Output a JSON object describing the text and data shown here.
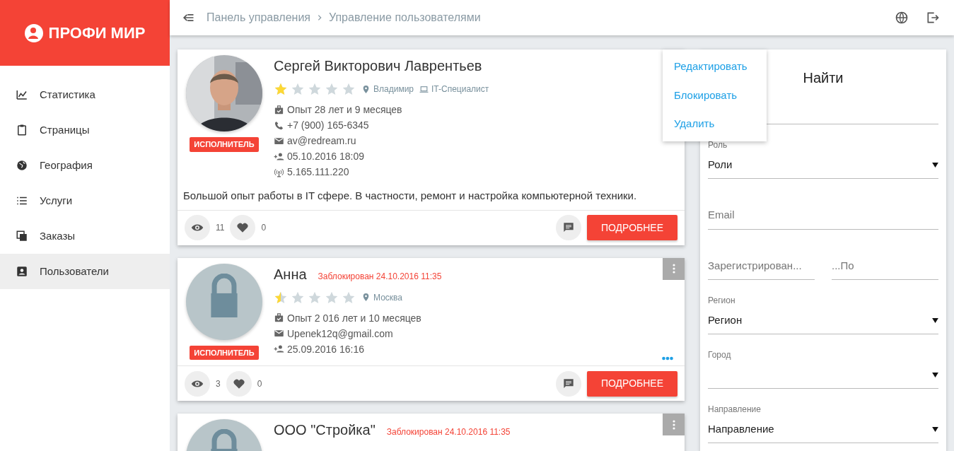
{
  "brand": {
    "name": "ПРОФИ МИР"
  },
  "sidebar": {
    "items": [
      {
        "label": "Статистика",
        "selected": false
      },
      {
        "label": "Страницы",
        "selected": false
      },
      {
        "label": "География",
        "selected": false
      },
      {
        "label": "Услуги",
        "selected": false
      },
      {
        "label": "Заказы",
        "selected": false
      },
      {
        "label": "Пользователи",
        "selected": true
      }
    ]
  },
  "breadcrumb": [
    "Панель управления",
    "Управление пользователями"
  ],
  "users": [
    {
      "name": "Сергей Викторович Лаврентьев",
      "stars": 1,
      "badge": "ИСПОЛНИТЕЛЬ",
      "menu_open": true,
      "meta": [
        {
          "kind": "city",
          "text": "Владимир"
        },
        {
          "kind": "profession",
          "text": "IT-Специалист"
        }
      ],
      "details": [
        {
          "kind": "experience",
          "text": "Опыт 28 лет и 9 месяцев"
        },
        {
          "kind": "phone",
          "text": "+7 (900) 165-6345"
        },
        {
          "kind": "email",
          "text": "av@redream.ru"
        },
        {
          "kind": "registered",
          "text": "05.10.2016 18:09"
        },
        {
          "kind": "ip",
          "text": "5.165.111.220"
        }
      ],
      "description": "Большой опыт работы в IT сфере. В частности, ремонт и настройка компьютерной техники.",
      "views": "11",
      "likes": "0",
      "details_button": "ПОДРОБНЕЕ"
    },
    {
      "name": "Анна",
      "blocked": "Заблокирован 24.10.2016 11:35",
      "kind": "locked",
      "stars": 0.5,
      "badge": "ИСПОЛНИТЕЛЬ",
      "menu_open": false,
      "more_dots": true,
      "meta": [
        {
          "kind": "city",
          "text": "Москва"
        }
      ],
      "details": [
        {
          "kind": "experience",
          "text": "Опыт 2 016 лет и 10 месяцев"
        },
        {
          "kind": "email",
          "text": "Upenek12q@gmail.com"
        },
        {
          "kind": "registered",
          "text": "25.09.2016 16:16"
        }
      ],
      "views": "3",
      "likes": "0",
      "details_button": "ПОДРОБНЕЕ"
    },
    {
      "name": "ООО \"Стройка\"",
      "blocked": "Заблокирован 24.10.2016 11:35",
      "kind": "locked",
      "menu_open": false
    }
  ],
  "context_menu": {
    "items": [
      "Редактировать",
      "Блокировать",
      "Удалить"
    ]
  },
  "filter": {
    "title": "Найти",
    "fields": [
      {
        "kind": "blank"
      },
      {
        "kind": "select",
        "label": "Роль",
        "value": "Роли"
      },
      {
        "kind": "text",
        "placeholder": "Email"
      },
      {
        "kind": "range",
        "from_placeholder": "Зарегистрирован...",
        "to_placeholder": "...По"
      },
      {
        "kind": "select",
        "label": "Регион",
        "value": "Регион"
      },
      {
        "kind": "select",
        "label": "Город"
      },
      {
        "kind": "select",
        "label": "Направление",
        "value": "Направление"
      }
    ]
  }
}
